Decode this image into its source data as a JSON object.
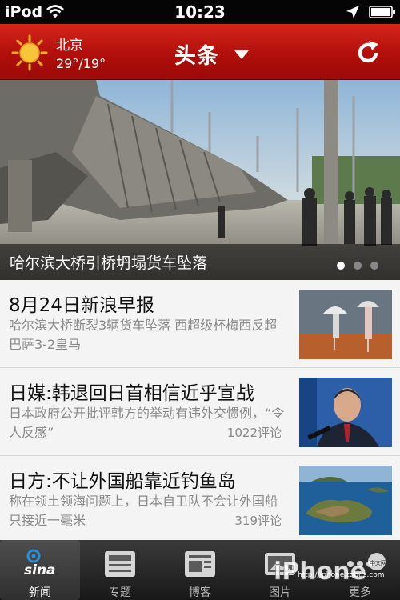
{
  "status_bar": {
    "carrier": "iPod",
    "time": "10:23"
  },
  "header": {
    "city": "北京",
    "temperature": "29°/19°",
    "title": "头条"
  },
  "hero": {
    "caption": "哈尔滨大桥引桥坍塌货车坠落",
    "active_index": 0,
    "dot_count": 3
  },
  "news": [
    {
      "title": "8月24日新浪早报",
      "summary": "哈尔滨大桥断裂3辆货车坠落 西超级杯梅西反超巴萨3-2皇马",
      "comments": ""
    },
    {
      "title": "日媒:韩退回日首相信近乎宣战",
      "summary": "日本政府公开批评韩方的举动有违外交惯例，“令人反感”",
      "comments": "1022评论"
    },
    {
      "title": "日方:不让外国船靠近钓鱼岛",
      "summary": "称在领土领海问题上，日本自卫队不会让外国船只接近一毫米",
      "comments": "319评论"
    }
  ],
  "tabs": [
    {
      "label": "新闻",
      "icon": "sina-logo-icon",
      "selected": true
    },
    {
      "label": "专题",
      "icon": "topics-icon",
      "selected": false
    },
    {
      "label": "博客",
      "icon": "blog-icon",
      "selected": false
    },
    {
      "label": "图片",
      "icon": "pictures-icon",
      "selected": false
    },
    {
      "label": "更多",
      "icon": "more-icon",
      "selected": false
    }
  ],
  "watermark": {
    "brand": "iPhone",
    "site_badge": "中文网",
    "url": "http://iphone.tgbus.com"
  },
  "colors": {
    "header_red": "#c4170f",
    "tab_bar": "#242424",
    "summary_gray": "#8a8a8a"
  }
}
